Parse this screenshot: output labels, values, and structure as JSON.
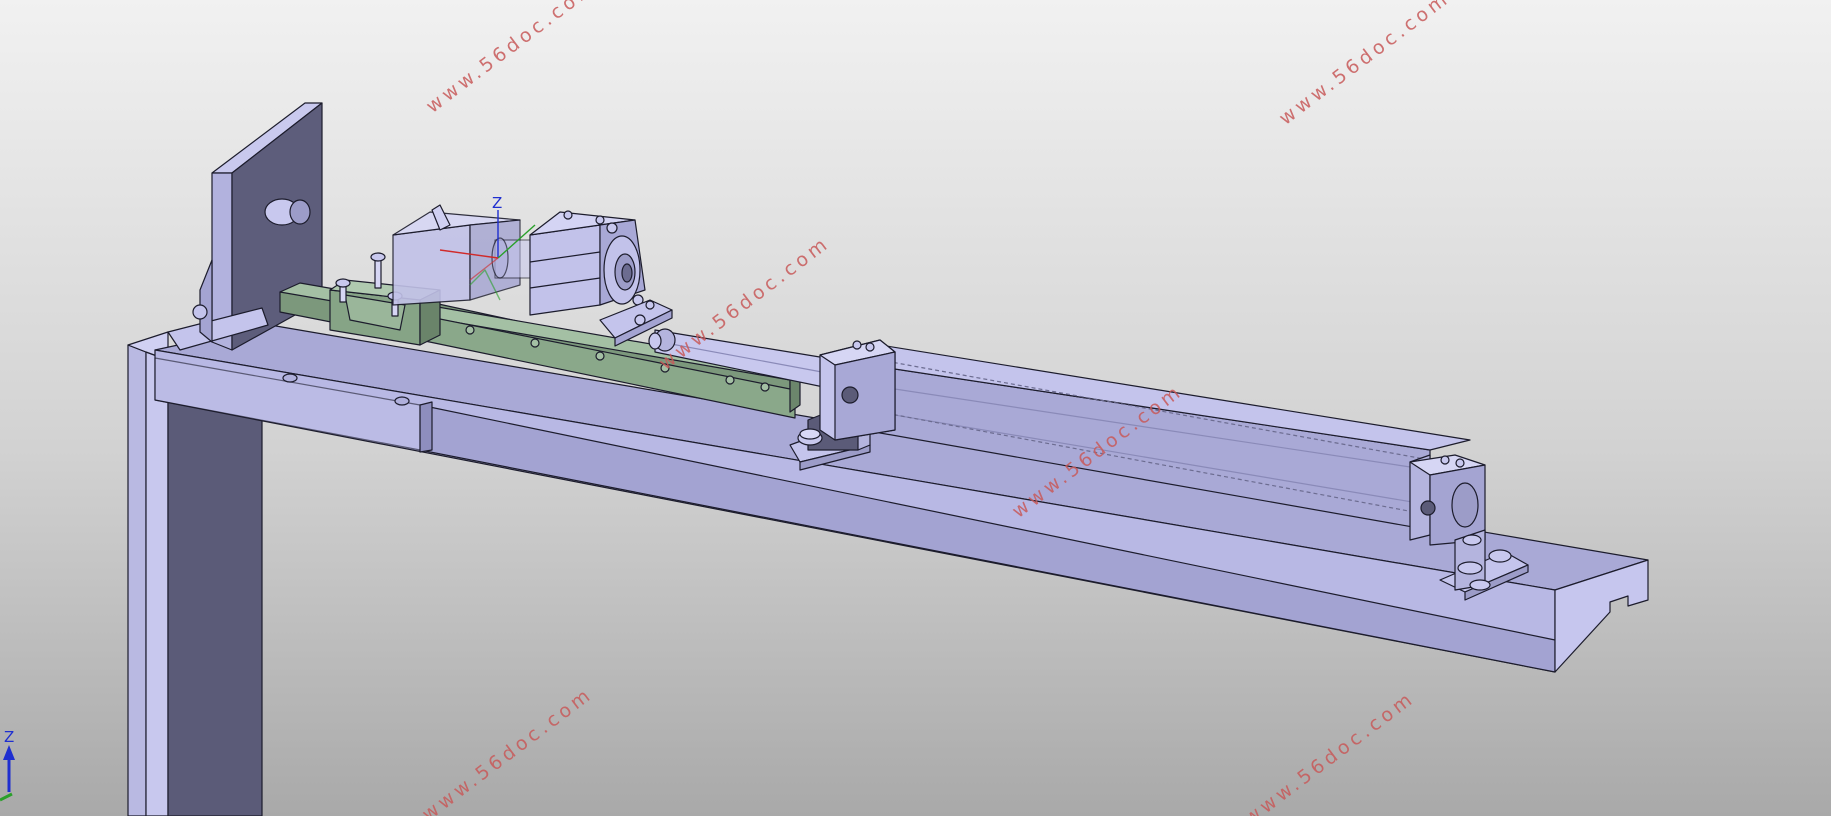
{
  "viewport": {
    "watermark": "www.56doc.com",
    "compass_axis_label": "Z",
    "local_axis_label": "Z",
    "colors": {
      "part_fill": "#a8a8d8",
      "part_light": "#c4c4ec",
      "part_dark": "#5b5b78",
      "rail_green": "#8aa88a",
      "outline": "#1c1c2c",
      "watermark": "#c85a5a"
    }
  }
}
